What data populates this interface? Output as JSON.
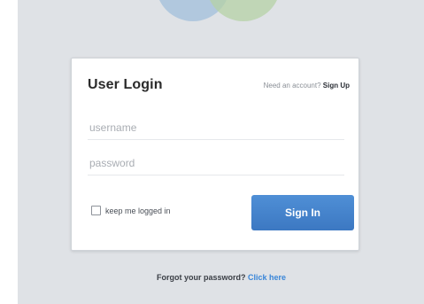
{
  "login": {
    "title": "User Login",
    "signup_prompt": "Need an account?",
    "signup_link": "Sign Up",
    "username_placeholder": "username",
    "password_placeholder": "password",
    "remember_label": "keep me logged in",
    "remember_checked": false,
    "signin_label": "Sign In"
  },
  "footer": {
    "forgot_prefix": "Forgot your password?",
    "forgot_link": "Click here"
  },
  "colors": {
    "background": "#dfe2e6",
    "card": "#ffffff",
    "primary_button": "#3c78c2",
    "link": "#3a86d8"
  },
  "icons": {
    "logo": "overlapping-circles-logo"
  }
}
